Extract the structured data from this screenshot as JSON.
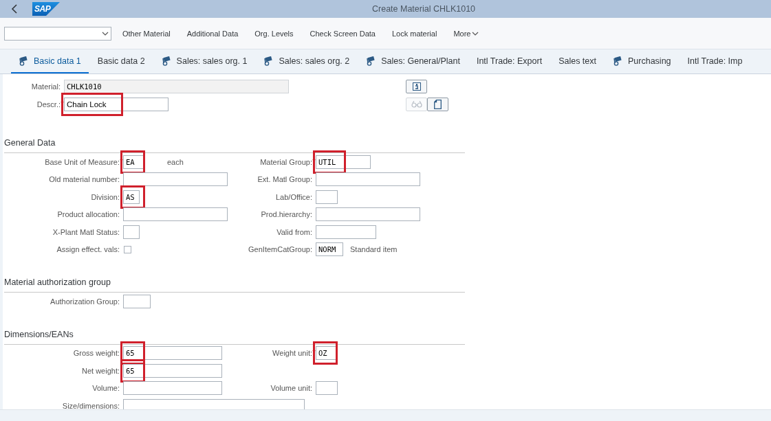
{
  "header": {
    "logo": "SAP",
    "title": "Create Material CHLK1010"
  },
  "toolbar": {
    "items": [
      "Other Material",
      "Additional Data",
      "Org. Levels",
      "Check Screen Data",
      "Lock material"
    ],
    "more": "More"
  },
  "tabs": [
    {
      "label": "Basic data 1",
      "selected": true,
      "kind": "icon"
    },
    {
      "label": "Basic data 2",
      "selected": false,
      "kind": "plain"
    },
    {
      "label": "Sales: sales org. 1",
      "selected": false,
      "kind": "icon"
    },
    {
      "label": "Sales: sales org. 2",
      "selected": false,
      "kind": "icon"
    },
    {
      "label": "Sales: General/Plant",
      "selected": false,
      "kind": "icon"
    },
    {
      "label": "Intl Trade: Export",
      "selected": false,
      "kind": "plain"
    },
    {
      "label": "Sales text",
      "selected": false,
      "kind": "plain"
    },
    {
      "label": "Purchasing",
      "selected": false,
      "kind": "icon"
    },
    {
      "label": "Intl Trade: Imp",
      "selected": false,
      "kind": "plain"
    }
  ],
  "top_fields": [
    {
      "label": "Material:",
      "value": "CHLK1010",
      "kind": "display",
      "required": false,
      "highlighted": false
    },
    {
      "label": "Descr.:",
      "value": "Chain Lock",
      "kind": "text",
      "required": true,
      "highlighted": true
    }
  ],
  "side_buttons": [
    {
      "kind": "info",
      "disabled": false
    },
    {
      "kind": "glasses",
      "disabled": true
    },
    {
      "kind": "page",
      "disabled": false
    }
  ],
  "sections": [
    {
      "title": "General Data",
      "rows": [
        {
          "left": {
            "label": "Base Unit of Measure:",
            "value": "EA",
            "kind": "short",
            "required": true,
            "highlighted": true,
            "note": "each"
          },
          "right": {
            "label": "Material Group:",
            "value": "UTIL",
            "kind": "unit",
            "required": true,
            "highlighted": true
          }
        },
        {
          "left": {
            "label": "Old material number:",
            "kind": "text",
            "required": false,
            "highlighted": false
          },
          "right": {
            "label": "Ext. Matl Group:",
            "kind": "text",
            "required": false,
            "highlighted": false
          }
        },
        {
          "left": {
            "label": "Division:",
            "value": "AS",
            "kind": "tiny",
            "required": false,
            "highlighted": true
          },
          "right": {
            "label": "Lab/Office:",
            "kind": "short",
            "required": false,
            "highlighted": false
          }
        },
        {
          "left": {
            "label": "Product allocation:",
            "kind": "text",
            "required": false,
            "highlighted": false
          },
          "right": {
            "label": "Prod.hierarchy:",
            "kind": "text",
            "required": false,
            "highlighted": false
          }
        },
        {
          "left": {
            "label": "X-Plant Matl Status:",
            "kind": "tiny",
            "required": false,
            "highlighted": false
          },
          "right": {
            "label": "Valid from:",
            "kind": "date",
            "required": false,
            "highlighted": false
          }
        },
        {
          "left": {
            "label": "Assign effect. vals:",
            "kind": "checkbox",
            "checked": false,
            "required": false,
            "highlighted": false
          },
          "right": {
            "label": "GenItemCatGroup:",
            "value": "NORM",
            "kind": "code",
            "required": false,
            "highlighted": false,
            "note": "Standard item"
          }
        }
      ]
    },
    {
      "title": "Material authorization group",
      "rows": [
        {
          "left": {
            "label": "Authorization Group:",
            "kind": "code",
            "required": false,
            "highlighted": false
          }
        }
      ]
    },
    {
      "title": "Dimensions/EANs",
      "rows": [
        {
          "left": {
            "label": "Gross weight:",
            "value": "65",
            "kind": "weight",
            "required": false,
            "highlighted": true
          },
          "right": {
            "label": "Weight unit:",
            "value": "OZ",
            "kind": "short",
            "required": true,
            "highlighted": true
          }
        },
        {
          "left": {
            "label": "Net weight:",
            "value": "65",
            "kind": "weight",
            "required": false,
            "highlighted": true
          }
        },
        {
          "left": {
            "label": "Volume:",
            "kind": "weight",
            "required": false,
            "highlighted": false
          },
          "right": {
            "label": "Volume unit:",
            "kind": "short",
            "required": false,
            "highlighted": false
          }
        },
        {
          "left": {
            "label": "Size/dimensions:",
            "kind": "wide",
            "required": false,
            "highlighted": false
          }
        }
      ]
    }
  ]
}
